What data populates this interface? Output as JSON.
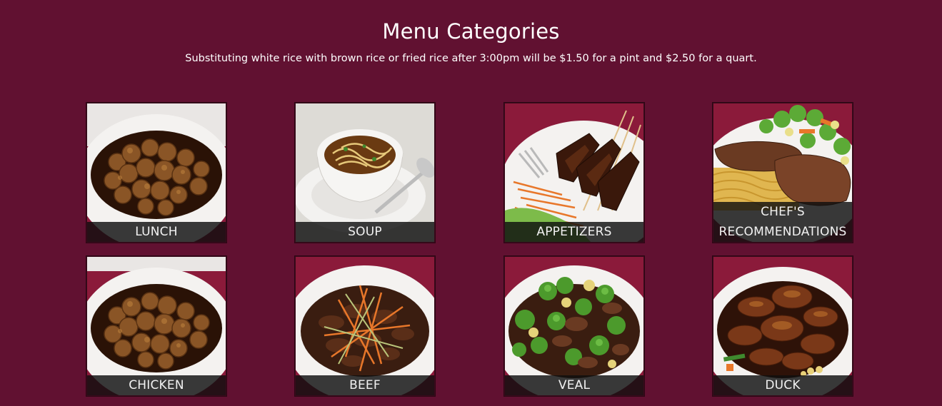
{
  "page": {
    "title": "Menu Categories",
    "subtitle": "Substituting white rice with brown rice or fried rice after 3:00pm will be $1.50 for a pint and $2.50 for a quart."
  },
  "categories": [
    {
      "label": "LUNCH",
      "icon": "orange-chicken-photo"
    },
    {
      "label": "SOUP",
      "icon": "noodle-soup-photo"
    },
    {
      "label": "APPETIZERS",
      "icon": "beef-skewers-photo"
    },
    {
      "label": "CHEF'S RECOMMENDATIONS",
      "icon": "steak-noodles-photo"
    },
    {
      "label": "CHICKEN",
      "icon": "orange-chicken-photo"
    },
    {
      "label": "BEEF",
      "icon": "shredded-beef-photo"
    },
    {
      "label": "VEAL",
      "icon": "veal-broccoli-photo"
    },
    {
      "label": "DUCK",
      "icon": "roast-duck-photo"
    }
  ],
  "colors": {
    "background": "#611131",
    "label_bar": "#0f0f0f",
    "text": "#ffffff"
  }
}
